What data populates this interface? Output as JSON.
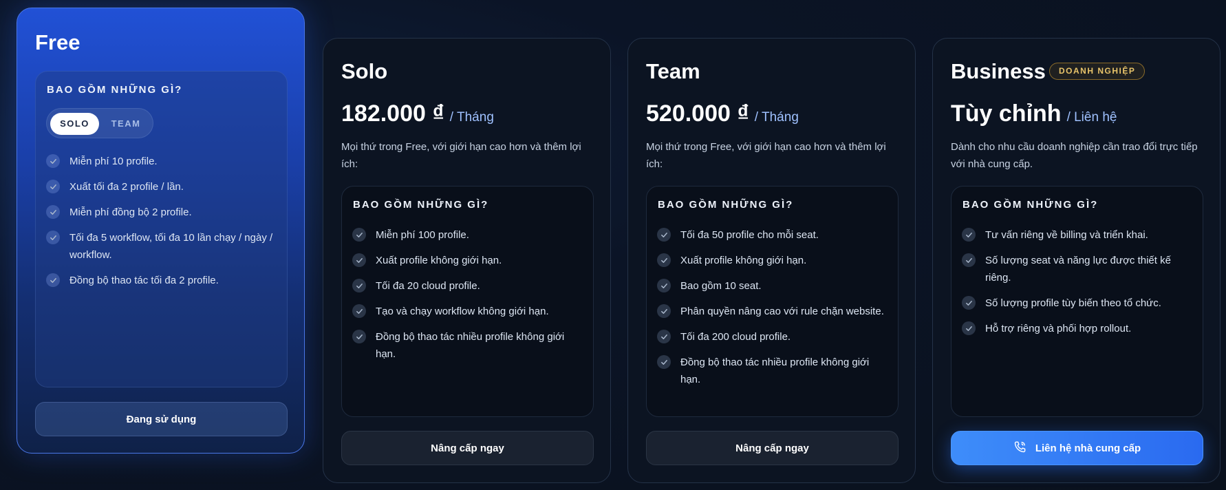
{
  "features_title": "BAO GỒM NHỮNG GÌ?",
  "plans": {
    "free": {
      "name": "Free",
      "toggle": {
        "active": "SOLO",
        "inactive": "TEAM"
      },
      "features": [
        "Miễn phí 10 profile.",
        "Xuất tối đa 2 profile / lần.",
        "Miễn phí đồng bộ 2 profile.",
        "Tối đa 5 workflow, tối đa 10 lần chạy / ngày / workflow.",
        "Đồng bộ thao tác tối đa 2 profile."
      ],
      "button": "Đang sử dụng"
    },
    "solo": {
      "name": "Solo",
      "price": "182.000 ₫",
      "period": "/ Tháng",
      "desc": "Mọi thứ trong Free, với giới hạn cao hơn và thêm lợi ích:",
      "features": [
        "Miễn phí 100 profile.",
        "Xuất profile không giới hạn.",
        "Tối đa 20 cloud profile.",
        "Tạo và chạy workflow không giới hạn.",
        "Đồng bộ thao tác nhiều profile không giới hạn."
      ],
      "button": "Nâng cấp ngay"
    },
    "team": {
      "name": "Team",
      "price": "520.000 ₫",
      "period": "/ Tháng",
      "desc": "Mọi thứ trong Free, với giới hạn cao hơn và thêm lợi ích:",
      "features": [
        "Tối đa 50 profile cho mỗi seat.",
        "Xuất profile không giới hạn.",
        "Bao gồm 10 seat.",
        "Phân quyền nâng cao với rule chặn website.",
        "Tối đa 200 cloud profile.",
        "Đồng bộ thao tác nhiều profile không giới hạn."
      ],
      "button": "Nâng cấp ngay"
    },
    "business": {
      "name": "Business",
      "badge": "DOANH NGHIỆP",
      "price": "Tùy chỉnh",
      "period": "/ Liên hệ",
      "desc": "Dành cho nhu cầu doanh nghiệp cần trao đổi trực tiếp với nhà cung cấp.",
      "features": [
        "Tư vấn riêng về billing và triển khai.",
        "Số lượng seat và năng lực được thiết kế riêng.",
        "Số lượng profile tùy biến theo tổ chức.",
        "Hỗ trợ riêng và phối hợp rollout."
      ],
      "button": "Liên hệ nhà cung cấp",
      "button_icon": "phone-icon"
    }
  },
  "colors": {
    "free_card": "#2151d6",
    "cta_blue": "#2a6af0",
    "badge_gold": "#e8c46a",
    "period_blue": "#9fc1ff"
  }
}
